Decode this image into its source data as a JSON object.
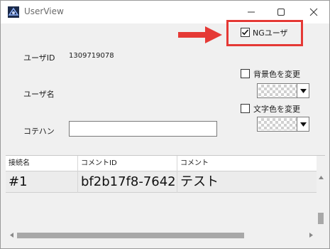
{
  "window": {
    "title": "UserView",
    "accent_color": "#e53935"
  },
  "form": {
    "user_id_label": "ユーザID",
    "user_id_value": "1309719078",
    "user_name_label": "ユーザ名",
    "kotehan_label": "コテハン",
    "kotehan_value": ""
  },
  "options": {
    "ng_user_label": "NGユーザ",
    "ng_user_checked": true,
    "bg_color_label": "背景色を変更",
    "bg_color_checked": false,
    "text_color_label": "文字色を変更",
    "text_color_checked": false
  },
  "grid": {
    "columns": [
      "接続名",
      "コメントID",
      "コメント"
    ],
    "rows": [
      [
        "#1",
        "bf2b17f8-7642",
        "テスト"
      ]
    ]
  }
}
